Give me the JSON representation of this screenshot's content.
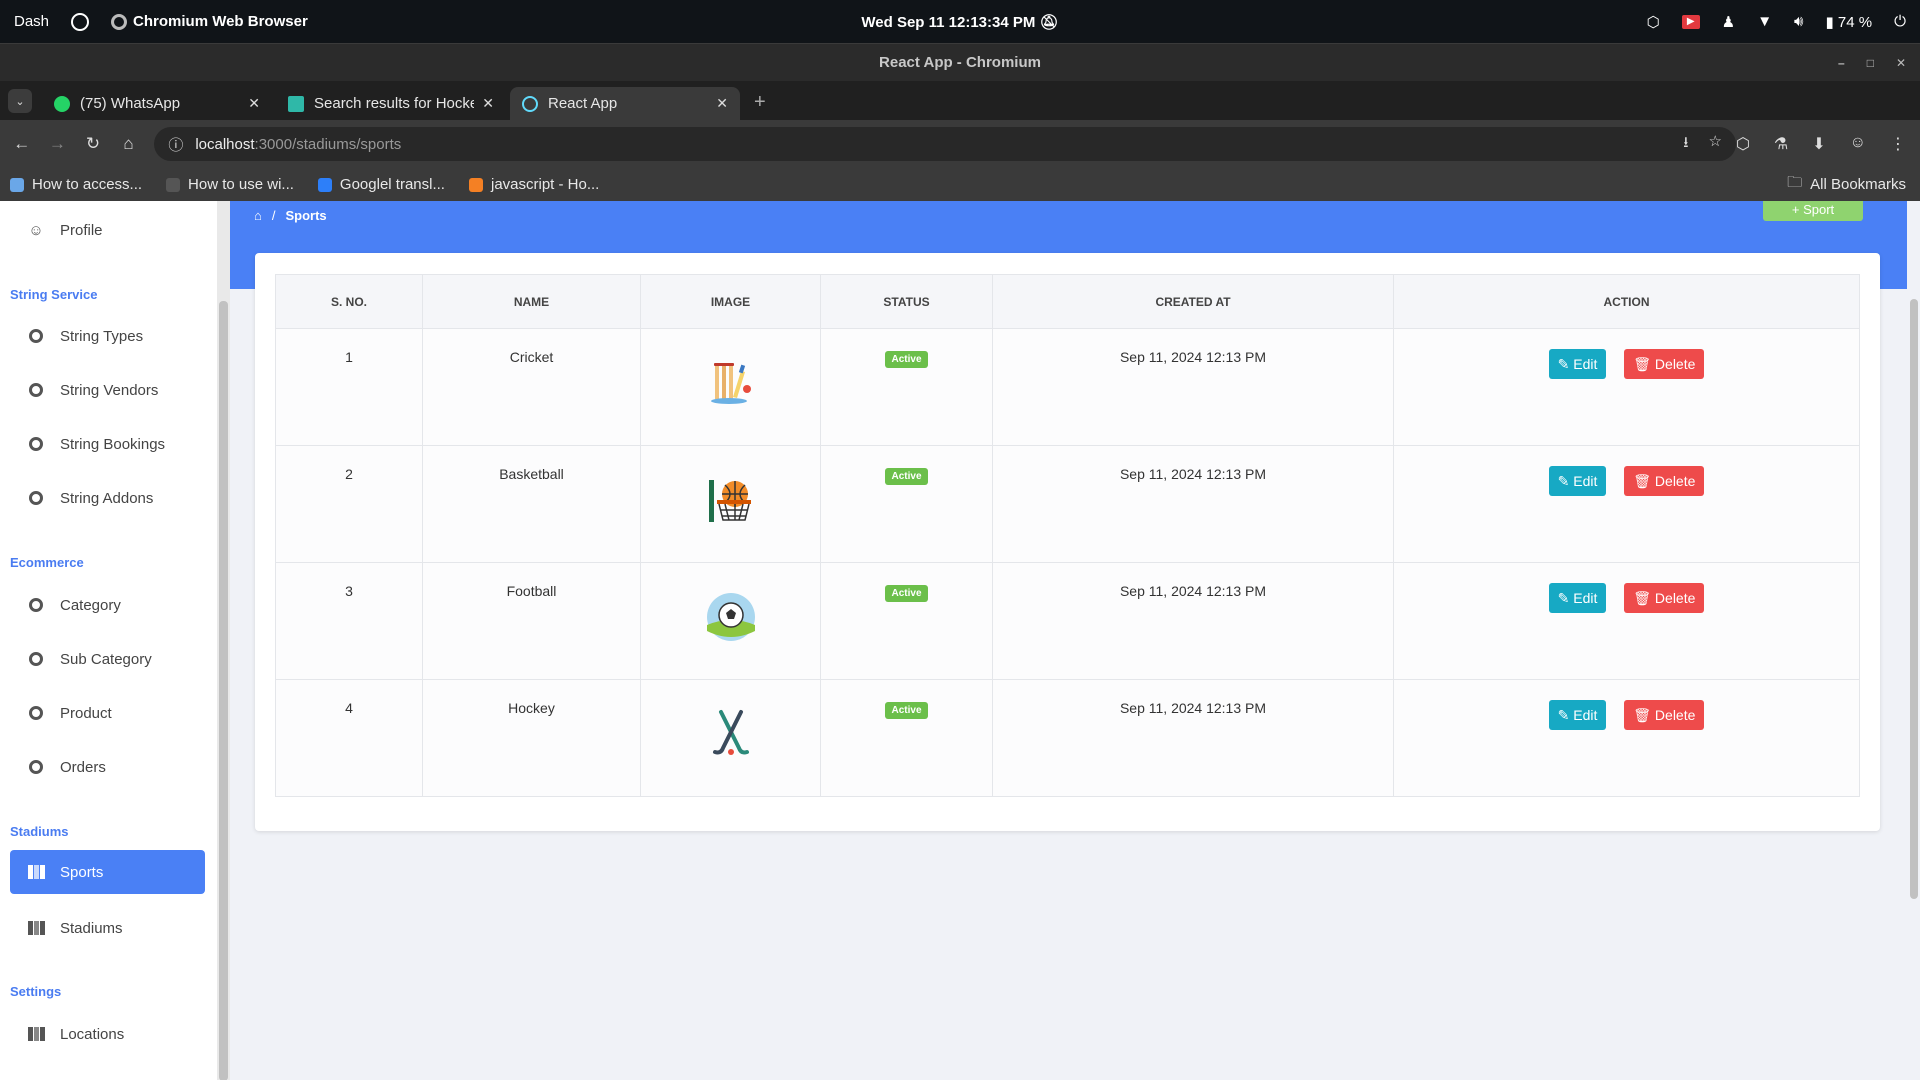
{
  "os": {
    "activities": "Dash",
    "app_name": "Chromium Web Browser",
    "datetime": "Wed Sep 11  12:13:34 PM",
    "battery": "74 %"
  },
  "window": {
    "title": "React App - Chromium"
  },
  "tabs": [
    {
      "label": "(75) WhatsApp",
      "color": "#25d366"
    },
    {
      "label": "Search results for Hocke",
      "color": "#2fb8a8"
    },
    {
      "label": "React App",
      "color": "#61dafb"
    }
  ],
  "address": {
    "host": "localhost",
    "path": ":3000/stadiums/sports"
  },
  "bookmarks": [
    {
      "label": "How to access...",
      "color": "#6aa7e8"
    },
    {
      "label": "How to use wi...",
      "color": "#555555"
    },
    {
      "label": "Googlel transl...",
      "color": "#2d7ff9"
    },
    {
      "label": "javascript - Ho...",
      "color": "#f48024"
    }
  ],
  "all_bookmarks": "All Bookmarks",
  "sidebar": {
    "profile": "Profile",
    "sections": [
      {
        "title": "String Service",
        "items": [
          "String Types",
          "String Vendors",
          "String Bookings",
          "String Addons"
        ]
      },
      {
        "title": "Ecommerce",
        "items": [
          "Category",
          "Sub Category",
          "Product",
          "Orders"
        ]
      },
      {
        "title": "Stadiums",
        "items": [
          "Sports",
          "Stadiums"
        ]
      },
      {
        "title": "Settings",
        "items": [
          "Locations"
        ]
      }
    ],
    "active_item": "Sports"
  },
  "breadcrumb": {
    "current": "Sports"
  },
  "add_button": "Sport",
  "table": {
    "headers": [
      "S. NO.",
      "NAME",
      "IMAGE",
      "STATUS",
      "CREATED AT",
      "ACTION"
    ],
    "rows": [
      {
        "sno": "1",
        "name": "Cricket",
        "image": "cricket-icon",
        "status": "Active",
        "created_at": "Sep 11, 2024 12:13 PM"
      },
      {
        "sno": "2",
        "name": "Basketball",
        "image": "basketball-icon",
        "status": "Active",
        "created_at": "Sep 11, 2024 12:13 PM"
      },
      {
        "sno": "3",
        "name": "Football",
        "image": "football-icon",
        "status": "Active",
        "created_at": "Sep 11, 2024 12:13 PM"
      },
      {
        "sno": "4",
        "name": "Hockey",
        "image": "hockey-icon",
        "status": "Active",
        "created_at": "Sep 11, 2024 12:13 PM"
      }
    ],
    "edit_label": "Edit",
    "delete_label": "Delete"
  },
  "colors": {
    "primary": "#4a80f5",
    "edit": "#17a9c4",
    "delete": "#ee4b4b",
    "active_badge": "#6bbf4a",
    "add_button": "#8fd36f"
  }
}
